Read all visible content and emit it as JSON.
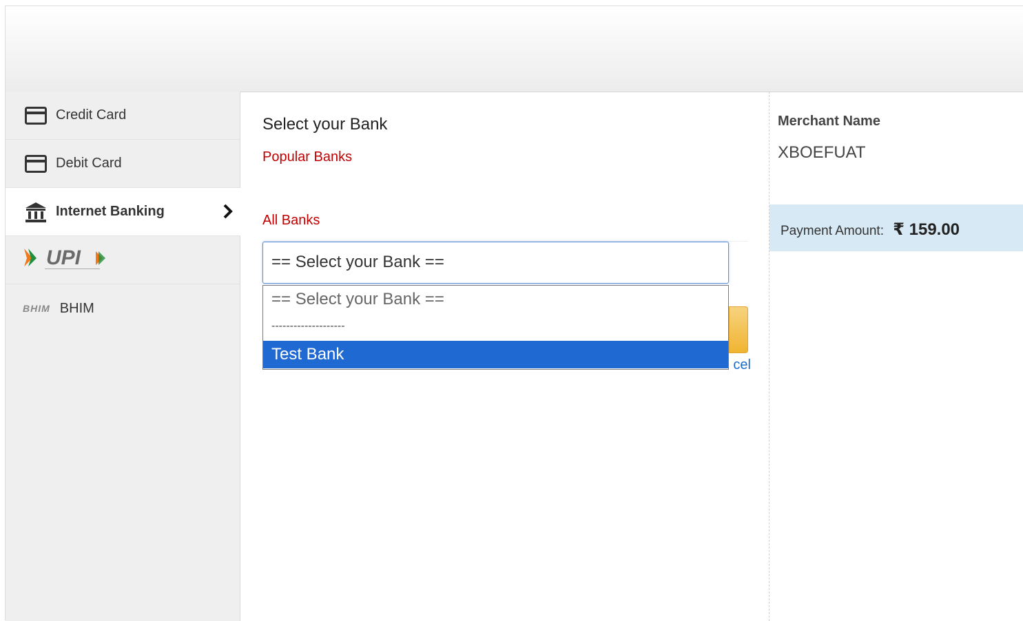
{
  "sidebar": {
    "items": [
      {
        "label": "Credit Card"
      },
      {
        "label": "Debit Card"
      },
      {
        "label": "Internet Banking"
      },
      {
        "label": "UPI"
      },
      {
        "label": "BHIM",
        "logo_text": "BHIM"
      }
    ]
  },
  "main": {
    "title": "Select your Bank",
    "popular_label": "Popular Banks",
    "all_banks_label": "All Banks",
    "bank_select": {
      "selected": "== Select your Bank ==",
      "options": [
        "== Select your Bank ==",
        "--------------------",
        "Test Bank"
      ],
      "highlighted": "Test Bank"
    },
    "cancel_label": "cel"
  },
  "summary": {
    "merchant_label": "Merchant Name",
    "merchant_value": "XBOEFUAT",
    "amount_label": "Payment Amount:",
    "currency_symbol": "₹",
    "amount_value": "159.00"
  },
  "colors": {
    "accent_red": "#c00000",
    "highlight_blue": "#1e69d2",
    "amount_bg": "#d7e9f5",
    "button_yellow": "#f0b431"
  }
}
